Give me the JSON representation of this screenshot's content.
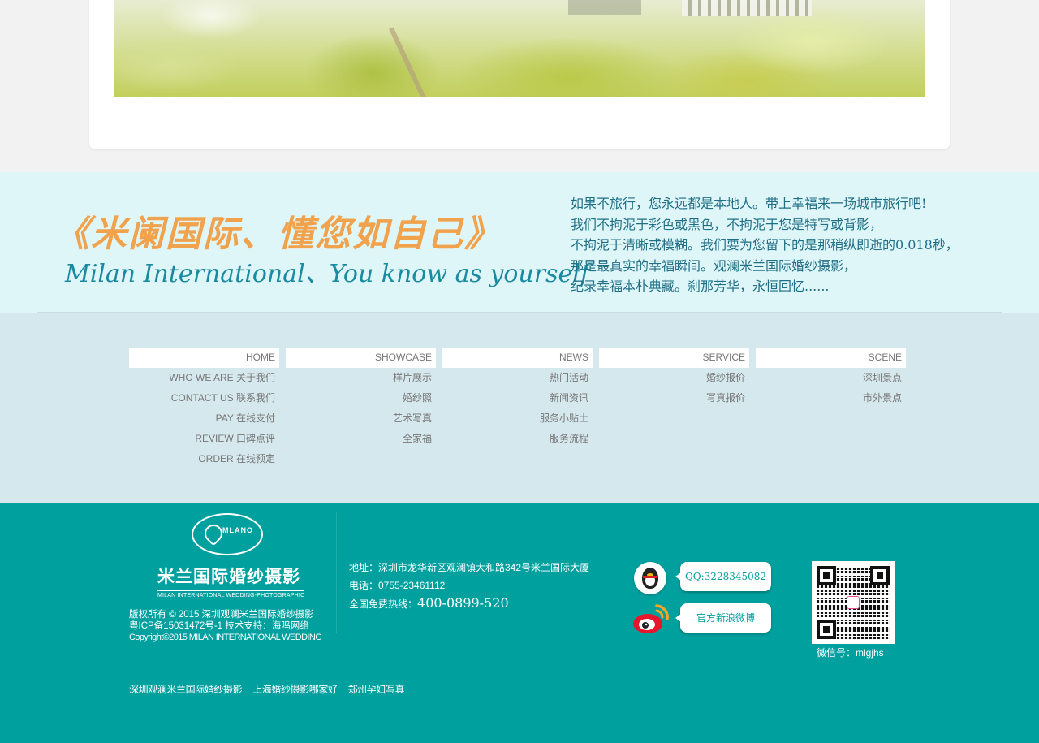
{
  "banner": {
    "slogan_cn": "《米阑国际、懂您如自己》",
    "slogan_en": "Milan International、You know as yourself",
    "intro": [
      "如果不旅行，您永远都是本地人。带上幸福来一场城市旅行吧!",
      "我们不拘泥于彩色或黑色，不拘泥于您是特写或背影，",
      "不拘泥于清晰或模糊。我们要为您留下的是那稍纵即逝的0.018秒，",
      "那是最真实的幸福瞬间。观澜米兰国际婚纱摄影，",
      "纪录幸福本朴典藏。刹那芳华，永恒回忆......"
    ]
  },
  "sitemap": [
    {
      "title": "HOME",
      "items": [
        "WHO WE ARE 关于我们",
        "CONTACT US 联系我们",
        "PAY 在线支付",
        "REVIEW 口碑点评",
        "ORDER 在线预定"
      ]
    },
    {
      "title": "SHOWCASE",
      "items": [
        "样片展示",
        "婚纱照",
        "艺术写真",
        "全家福"
      ]
    },
    {
      "title": "NEWS",
      "items": [
        "热门活动",
        "新闻资讯",
        "服务小贴士",
        "服务流程"
      ]
    },
    {
      "title": "SERVICE",
      "items": [
        "婚纱报价",
        "写真报价"
      ]
    },
    {
      "title": "SCENE",
      "items": [
        "深圳景点",
        "市外景点"
      ]
    }
  ],
  "footer": {
    "logo": {
      "mark": "MLANO",
      "cn": "米兰国际婚纱摄影",
      "en": "MILAN INTERNATIONAL WEDDING-PHOTOGRAPHIC"
    },
    "copyright": [
      "版权所有 © 2015 深圳观澜米兰国际婚纱摄影",
      "粤ICP备15031472号-1 技术支持：海鸣网络",
      "Copyright©2015 MILAN INTERNATIONAL WEDDING"
    ],
    "address": "地址：深圳市龙华新区观澜镇大和路342号米兰国际大厦",
    "phone": "电话：0755-23461112",
    "hotline_label": "全国免费热线：",
    "hotline_number": "400-0899-520",
    "qq": "QQ:3228345082",
    "weibo": "官方新浪微博",
    "wechat": "微信号：mlgjhs",
    "links": [
      "深圳观澜米兰国际婚纱摄影",
      "上海婚纱摄影哪家好",
      "郑州孕妇写真"
    ]
  },
  "colors": {
    "footer_bg": "#00a09f",
    "sitemap_bg": "#d5e8ed",
    "banner_bg": "#dff6f8",
    "slogan_orange": "#f0a24c",
    "slogan_teal": "#1a8aa0"
  }
}
